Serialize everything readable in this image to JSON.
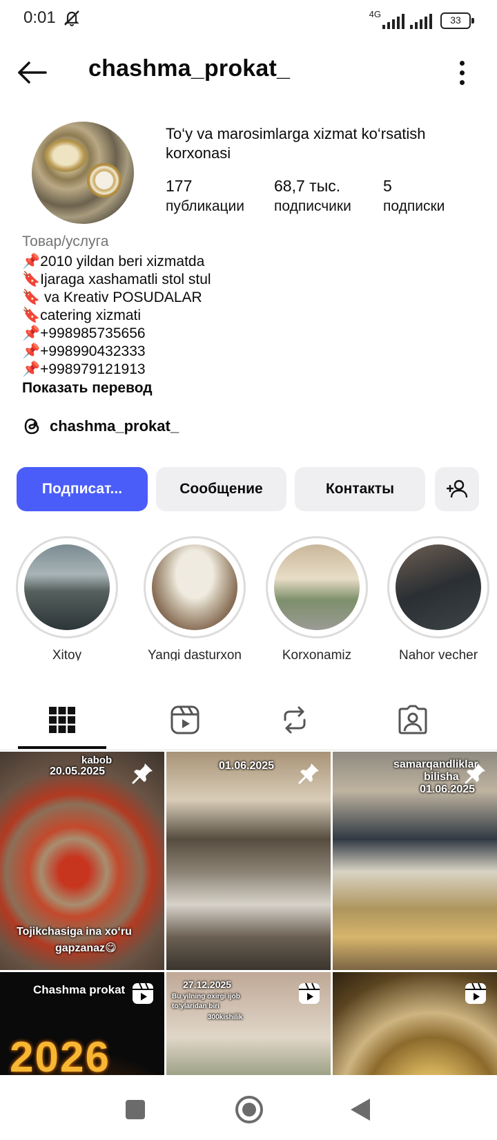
{
  "status_bar": {
    "time": "0:01",
    "network": "4G",
    "battery": "33",
    "icons": [
      "mute-icon",
      "signal-icon",
      "battery-icon"
    ]
  },
  "header": {
    "username": "chashma_prokat_",
    "icons": [
      "back-arrow-icon",
      "more-vertical-icon"
    ]
  },
  "profile": {
    "name": "To‘y va marosimlarga xizmat ko‘rsatish korxonasi",
    "stats": [
      {
        "value": "177",
        "label": "публикации"
      },
      {
        "value": "68,7 тыс.",
        "label": "подписчики"
      },
      {
        "value": "5",
        "label": "подписки"
      }
    ],
    "category": "Товар/услуга",
    "bio_lines": [
      "📌2010 yildan beri xizmatda",
      " 🔖Ijaraga xashamatli stol stul",
      " 🔖 va Kreativ POSUDALAR",
      "🔖catering xizmati",
      "📌+998985735656",
      "📌+998990432333",
      "📌+998979121913"
    ],
    "translate_link": "Показать перевод",
    "threads_handle": "chashma_prokat_"
  },
  "actions": {
    "follow": "Подписат...",
    "message": "Сообщение",
    "contacts": "Контакты",
    "add_user_icon": "add-person-icon"
  },
  "highlights": [
    {
      "label": "Xitoy"
    },
    {
      "label": "Yangi dasturxon"
    },
    {
      "label": "Korxonamiz"
    },
    {
      "label": "Nahor vecher"
    }
  ],
  "tabs": [
    {
      "name": "grid",
      "icon": "grid-icon",
      "active": true
    },
    {
      "name": "reels",
      "icon": "reels-icon",
      "active": false
    },
    {
      "name": "reposts",
      "icon": "repost-icon",
      "active": false
    },
    {
      "name": "tagged",
      "icon": "tagged-person-icon",
      "active": false
    }
  ],
  "posts": [
    {
      "pinned": true,
      "captions": [
        "kabob",
        "20.05.2025",
        "Tojikchasiga ina xo‘ru",
        "gapzanaz😋"
      ]
    },
    {
      "pinned": true,
      "captions": [
        "01.06.2025"
      ]
    },
    {
      "pinned": true,
      "captions": [
        "samarqandliklar",
        "bilisha",
        "01.06.2025"
      ]
    },
    {
      "reel": true,
      "captions": [
        "Chashma prokat",
        "2026"
      ]
    },
    {
      "reel": true,
      "captions": [
        "27.12.2025",
        "Bu yilning oxirgi ijob",
        "to‘ylaridan biri",
        "300kishilik"
      ]
    },
    {
      "reel": true,
      "captions": []
    }
  ],
  "colors": {
    "accent": "#4a5df9",
    "button_bg": "#efeff2",
    "muted_text": "#737373"
  }
}
